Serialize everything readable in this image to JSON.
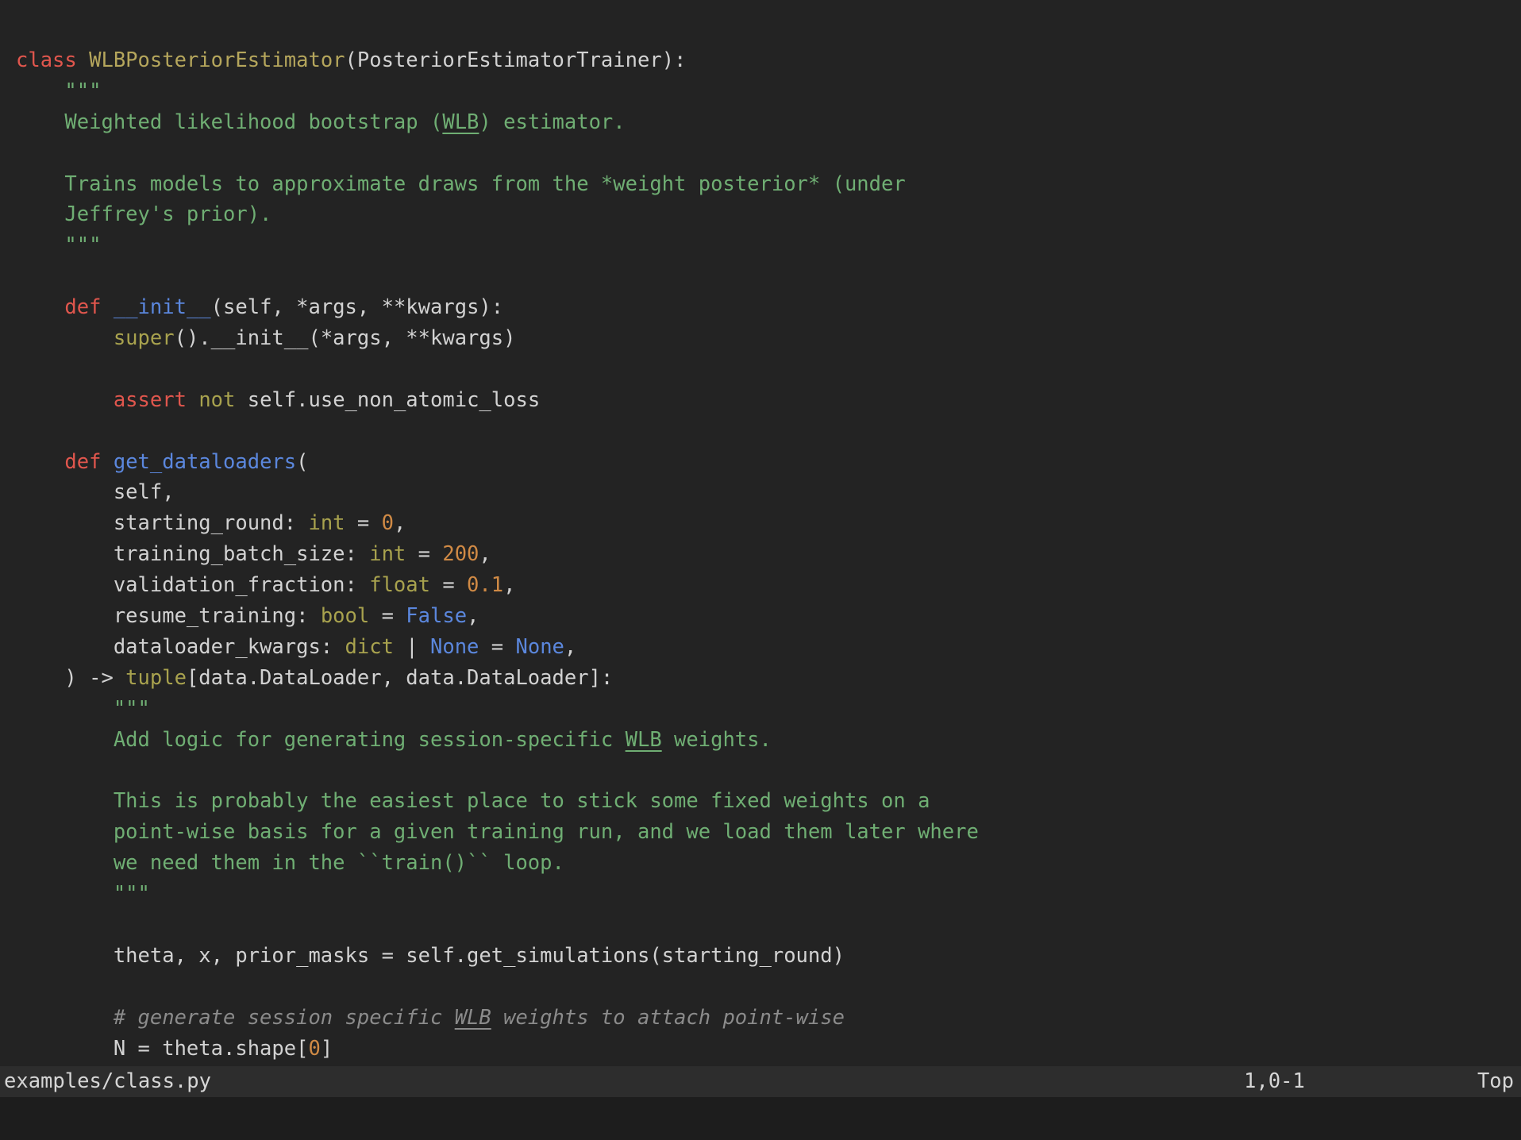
{
  "editor": {
    "colors": {
      "background": "#232323",
      "plain": "#d2d2d2",
      "keyword": "#e0564d",
      "classname": "#b5a65c",
      "type": "#a8a24e",
      "function": "#5b87dd",
      "constant": "#5b87dd",
      "number": "#d08a45",
      "string": "#6fae73",
      "comment": "#8b8b8b",
      "statusbar_bg": "#2d2d2d",
      "statusbar_text": "#d6d6d6",
      "cmdline_bg": "#1d1d1d"
    },
    "code_lines": [
      [
        [
          "kw",
          "class"
        ],
        [
          "pl",
          " "
        ],
        [
          "cn",
          "WLBPosteriorEstimator"
        ],
        [
          "pl",
          "(PosteriorEstimatorTrainer):"
        ]
      ],
      [
        [
          "st",
          "    \"\"\""
        ]
      ],
      [
        [
          "st",
          "    Weighted likelihood bootstrap ("
        ],
        [
          "stu",
          "WLB"
        ],
        [
          "st",
          ") estimator."
        ]
      ],
      [],
      [
        [
          "st",
          "    Trains models to approximate draws from the *weight posterior* (under"
        ]
      ],
      [
        [
          "st",
          "    Jeffrey's prior)."
        ]
      ],
      [
        [
          "st",
          "    \"\"\""
        ]
      ],
      [],
      [
        [
          "pl",
          "    "
        ],
        [
          "kw",
          "def"
        ],
        [
          "pl",
          " "
        ],
        [
          "fn",
          "__init__"
        ],
        [
          "pl",
          "(self, *args, **kwargs):"
        ]
      ],
      [
        [
          "pl",
          "        "
        ],
        [
          "ty",
          "super"
        ],
        [
          "pl",
          "().__init__(*args, **kwargs)"
        ]
      ],
      [],
      [
        [
          "pl",
          "        "
        ],
        [
          "kw",
          "assert"
        ],
        [
          "pl",
          " "
        ],
        [
          "ty",
          "not"
        ],
        [
          "pl",
          " self.use_non_atomic_loss"
        ]
      ],
      [],
      [
        [
          "pl",
          "    "
        ],
        [
          "kw",
          "def"
        ],
        [
          "pl",
          " "
        ],
        [
          "fn",
          "get_dataloaders"
        ],
        [
          "pl",
          "("
        ]
      ],
      [
        [
          "pl",
          "        self,"
        ]
      ],
      [
        [
          "pl",
          "        starting_round: "
        ],
        [
          "ty",
          "int"
        ],
        [
          "pl",
          " = "
        ],
        [
          "nu",
          "0"
        ],
        [
          "pl",
          ","
        ]
      ],
      [
        [
          "pl",
          "        training_batch_size: "
        ],
        [
          "ty",
          "int"
        ],
        [
          "pl",
          " = "
        ],
        [
          "nu",
          "200"
        ],
        [
          "pl",
          ","
        ]
      ],
      [
        [
          "pl",
          "        validation_fraction: "
        ],
        [
          "ty",
          "float"
        ],
        [
          "pl",
          " = "
        ],
        [
          "nu",
          "0.1"
        ],
        [
          "pl",
          ","
        ]
      ],
      [
        [
          "pl",
          "        resume_training: "
        ],
        [
          "ty",
          "bool"
        ],
        [
          "pl",
          " = "
        ],
        [
          "co",
          "False"
        ],
        [
          "pl",
          ","
        ]
      ],
      [
        [
          "pl",
          "        dataloader_kwargs: "
        ],
        [
          "ty",
          "dict"
        ],
        [
          "pl",
          " | "
        ],
        [
          "co",
          "None"
        ],
        [
          "pl",
          " = "
        ],
        [
          "co",
          "None"
        ],
        [
          "pl",
          ","
        ]
      ],
      [
        [
          "pl",
          "    ) -> "
        ],
        [
          "ty",
          "tuple"
        ],
        [
          "pl",
          "[data.DataLoader, data.DataLoader]:"
        ]
      ],
      [
        [
          "st",
          "        \"\"\""
        ]
      ],
      [
        [
          "st",
          "        Add logic for generating session-specific "
        ],
        [
          "stu",
          "WLB"
        ],
        [
          "st",
          " weights."
        ]
      ],
      [],
      [
        [
          "st",
          "        This is probably the easiest place to stick some fixed weights on a"
        ]
      ],
      [
        [
          "st",
          "        point-wise basis for a given training run, and we load them later where"
        ]
      ],
      [
        [
          "st",
          "        we need them in the ``train()`` loop."
        ]
      ],
      [
        [
          "st",
          "        \"\"\""
        ]
      ],
      [],
      [
        [
          "pl",
          "        theta, x, prior_masks = self.get_simulations(starting_round)"
        ]
      ],
      [],
      [
        [
          "cm",
          "        # generate session specific "
        ],
        [
          "cmu",
          "WLB"
        ],
        [
          "cm",
          " weights to attach point-wise"
        ]
      ],
      [
        [
          "pl",
          "        N = theta.shape["
        ],
        [
          "nu",
          "0"
        ],
        [
          "pl",
          "]"
        ]
      ]
    ]
  },
  "status_bar": {
    "filename": "examples/class.py",
    "ruler": "1,0-1",
    "scroll_position": "Top"
  }
}
